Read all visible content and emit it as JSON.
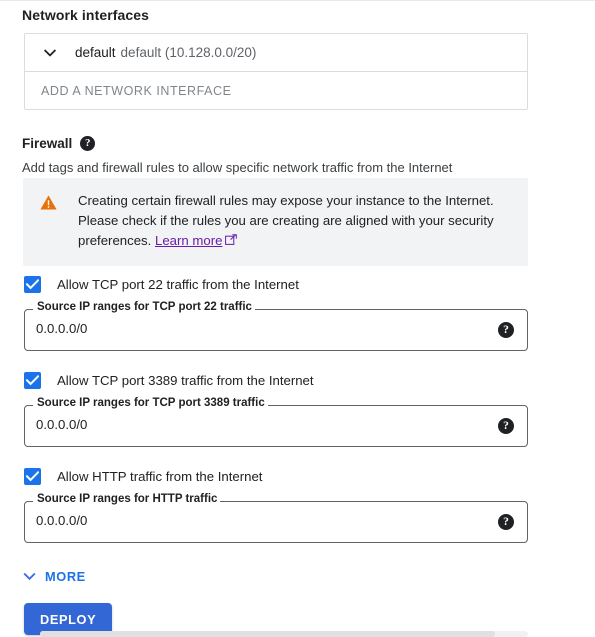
{
  "network_interfaces": {
    "title": "Network interfaces",
    "rows": [
      {
        "name": "default",
        "details": "default (10.128.0.0/20)",
        "expand_icon": "chevron-down-icon"
      }
    ],
    "add_label": "ADD A NETWORK INTERFACE"
  },
  "firewall": {
    "title": "Firewall",
    "help_icon": "help-circle-icon",
    "help_glyph": "?",
    "description": "Add tags and firewall rules to allow specific network traffic from the Internet",
    "warning": {
      "icon": "warning-triangle-icon",
      "text": "Creating certain firewall rules may expose your instance to the Internet. Please check if the rules you are creating are aligned with your security preferences.",
      "link_label": "Learn more",
      "link_icon": "external-link-icon"
    },
    "rules": [
      {
        "checkbox_label": "Allow TCP port 22 traffic from the Internet",
        "checked": true,
        "field_label": "Source IP ranges for TCP port 22 traffic",
        "field_value": "0.0.0.0/0",
        "field_placeholder": "0.0.0.0/0",
        "field_help_icon": "help-circle-icon",
        "field_help_glyph": "?"
      },
      {
        "checkbox_label": "Allow TCP port 3389 traffic from the Internet",
        "checked": true,
        "field_label": "Source IP ranges for TCP port 3389 traffic",
        "field_value": "0.0.0.0/0",
        "field_placeholder": "0.0.0.0/0",
        "field_help_icon": "help-circle-icon",
        "field_help_glyph": "?"
      },
      {
        "checkbox_label": "Allow HTTP traffic from the Internet",
        "checked": true,
        "field_label": "Source IP ranges for HTTP traffic",
        "field_value": "0.0.0.0/0",
        "field_placeholder": "0.0.0.0/0",
        "field_help_icon": "help-circle-icon",
        "field_help_glyph": "?"
      }
    ]
  },
  "footer": {
    "more_label": "MORE",
    "more_icon": "chevron-down-icon",
    "deploy_label": "DEPLOY"
  },
  "colors": {
    "accent_blue": "#1a73e8",
    "deploy_blue": "#3367d6",
    "warning_orange": "#e8710a",
    "link_purple": "#681da8",
    "warning_bg": "#f1f3f4",
    "border_gray": "#dadce0",
    "text_secondary": "#5f6368"
  }
}
